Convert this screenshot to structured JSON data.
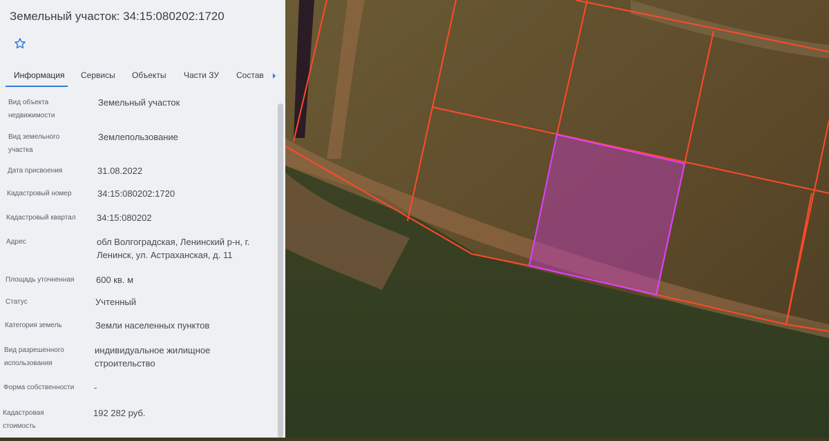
{
  "panel": {
    "title": "Земельный участок: 34:15:080202:1720",
    "tabs": [
      "Информация",
      "Сервисы",
      "Объекты",
      "Части ЗУ",
      "Состав"
    ],
    "rows": [
      {
        "label": "Вид объекта недвижимости",
        "value": "Земельный участок"
      },
      {
        "label": "Вид земельного участка",
        "value": "Землепользование"
      },
      {
        "label": "Дата присвоения",
        "value": "31.08.2022"
      },
      {
        "label": "Кадастровый номер",
        "value": "34:15:080202:1720"
      },
      {
        "label": "Кадастровый квартал",
        "value": "34:15:080202"
      },
      {
        "label": "Адрес",
        "value": "обл Волгоградская, Ленинский р-н, г. Ленинск, ул. Астраханская, д. 11"
      },
      {
        "label": "Площадь уточненная",
        "value": "600 кв. м"
      },
      {
        "label": "Статус",
        "value": "Учтенный"
      },
      {
        "label": "Категория земель",
        "value": "Земли населенных пунктов"
      },
      {
        "label": "Вид разрешенного использования",
        "value": "индивидуальное жилищное строительство"
      },
      {
        "label": "Форма собственности",
        "value": "-"
      },
      {
        "label": "Кадастровая стоимость",
        "value": "192 282 руб."
      }
    ]
  },
  "colors": {
    "accent": "#2e7bd6",
    "parcel_border": "#ff4a2a",
    "selected_parcel": "#e040ff"
  },
  "icons": {
    "favorite": "star-outline-icon",
    "tabs_more": "chevron-right-icon"
  }
}
